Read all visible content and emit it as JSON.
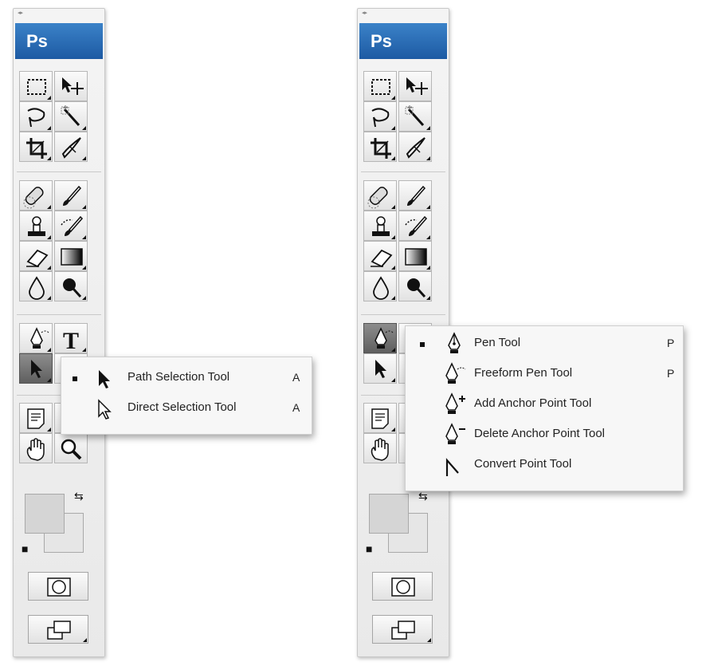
{
  "app": {
    "logo_text": "Ps"
  },
  "panels": [
    {
      "flyout": {
        "items": [
          {
            "label": "Path Selection Tool",
            "shortcut": "A",
            "selected": true,
            "icon": "path-selection-arrow-icon"
          },
          {
            "label": "Direct Selection Tool",
            "shortcut": "A",
            "selected": false,
            "icon": "direct-selection-arrow-icon"
          }
        ]
      }
    },
    {
      "flyout": {
        "items": [
          {
            "label": "Pen Tool",
            "shortcut": "P",
            "selected": true,
            "icon": "pen-icon"
          },
          {
            "label": "Freeform Pen Tool",
            "shortcut": "P",
            "selected": false,
            "icon": "freeform-pen-icon"
          },
          {
            "label": "Add Anchor Point Tool",
            "shortcut": "",
            "selected": false,
            "icon": "add-anchor-point-icon"
          },
          {
            "label": "Delete Anchor Point Tool",
            "shortcut": "",
            "selected": false,
            "icon": "delete-anchor-point-icon"
          },
          {
            "label": "Convert Point Tool",
            "shortcut": "",
            "selected": false,
            "icon": "convert-point-icon"
          }
        ]
      }
    }
  ],
  "tools": [
    "rectangular-marquee-icon",
    "move-icon",
    "lasso-icon",
    "magic-wand-icon",
    "crop-icon",
    "slice-icon",
    "healing-brush-icon",
    "brush-icon",
    "clone-stamp-icon",
    "history-brush-icon",
    "eraser-icon",
    "gradient-icon",
    "blur-icon",
    "dodge-icon",
    "pen-icon",
    "type-icon",
    "path-selection-icon",
    "shape-icon",
    "notes-icon",
    "eyedropper-icon",
    "hand-icon",
    "zoom-icon"
  ]
}
